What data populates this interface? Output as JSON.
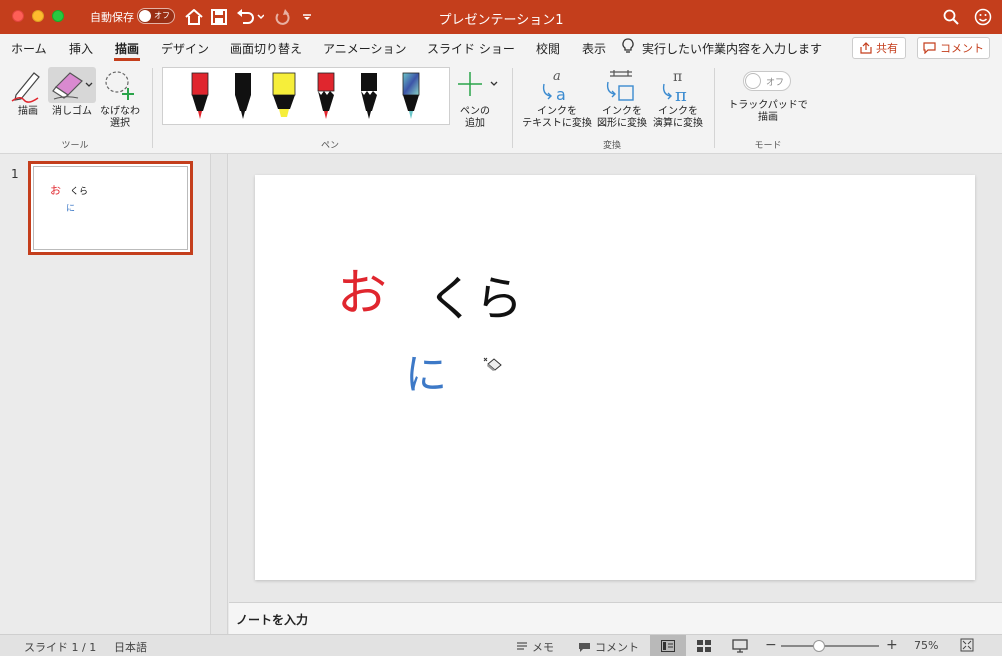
{
  "titlebar": {
    "autosave_label": "自動保存",
    "autosave_state": "オフ",
    "title": "プレゼンテーション1"
  },
  "tabs": [
    {
      "label": "ホーム"
    },
    {
      "label": "挿入"
    },
    {
      "label": "描画",
      "active": true
    },
    {
      "label": "デザイン"
    },
    {
      "label": "画面切り替え"
    },
    {
      "label": "アニメーション"
    },
    {
      "label": "スライド ショー"
    },
    {
      "label": "校閲"
    },
    {
      "label": "表示"
    }
  ],
  "tell_me": "実行したい作業内容を入力します",
  "share_label": "共有",
  "comment_label": "コメント",
  "ribbon": {
    "tools": {
      "draw": "描画",
      "eraser": "消しゴム",
      "lasso": "なげなわ\n選択",
      "group": "ツール"
    },
    "pens": {
      "add_pen": "ペンの\n追加",
      "group": "ペン",
      "colors": [
        "#e0262e",
        "#111111",
        "#f6ee3a",
        "#e0262e",
        "#111111",
        "#3d79c7"
      ]
    },
    "convert": {
      "to_text": "インクを\nテキストに変換",
      "to_shape": "インクを\n図形に変換",
      "to_math": "インクを\n演算に変換",
      "group": "変換"
    },
    "mode": {
      "toggle_state": "オフ",
      "trackpad": "トラックパッドで\n描画",
      "group": "モード"
    }
  },
  "thumbnails": [
    {
      "number": "1"
    }
  ],
  "slide": {
    "ink": {
      "o": "お",
      "kura": "くら",
      "ni": "に"
    }
  },
  "notes_placeholder": "ノートを入力",
  "statusbar": {
    "slide_info": "スライド 1 / 1",
    "language": "日本語",
    "notes": "メモ",
    "comments": "コメント",
    "zoom": "75%"
  },
  "colors": {
    "accent": "#c43e1c",
    "ink_red": "#e0262e",
    "ink_black": "#111111",
    "ink_blue": "#3d79c7"
  }
}
